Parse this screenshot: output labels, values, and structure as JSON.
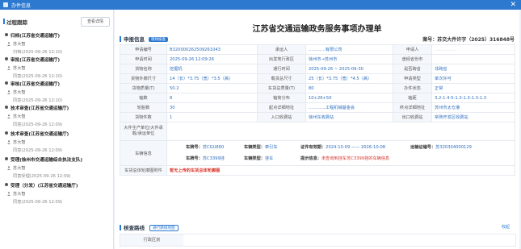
{
  "window": {
    "title": "办件信息",
    "close_glyph": "✕"
  },
  "sidebar": {
    "title": "过程跟踪",
    "view_btn": "查看详情",
    "items": [
      {
        "name": "归档(江苏省交通运输厅)",
        "user": "苏大智",
        "time": "归档(2025-09-26 12:10)"
      },
      {
        "name": "审批(江苏省交通运输厅)",
        "user": "苏大智",
        "time": "同意(2025-09-26 12:10)"
      },
      {
        "name": "审核(江苏省交通运输厅)",
        "user": "苏大智",
        "time": "同意(2025-09-26 12:10)"
      },
      {
        "name": "技术审查(江苏省交通运输厅)",
        "user": "苏大智",
        "time": "同意(2025-09-26 12:09)"
      },
      {
        "name": "技术审查(江苏省交通运输厅)",
        "user": "苏大智",
        "time": "同意(2025-09-26 12:09)"
      },
      {
        "name": "受理(徐州市交通运输综合执法支队)",
        "user": "苏大智",
        "time": "同意受理(2025-09-26 12:09)"
      },
      {
        "name": "受理（分发）(江苏省交通运输厅)",
        "user": "苏大智",
        "time": "同意(2025-09-26 12:09)"
      }
    ]
  },
  "main": {
    "doc_title": "江苏省交通运输政务服务事项办理单",
    "section1": "申报信息",
    "section1_tag": "现场核查",
    "serial": "案号：苏交大件许字（2025）316848号",
    "table": {
      "r1": [
        "申请编号",
        "B320000262509261043",
        "承运人",
        "…………有限公司",
        "申请人",
        "……………"
      ],
      "r2": [
        "申请时间",
        "2025-09-26 12:09:26",
        "出发地行政区",
        "徐州市→苏州市",
        "途经省份市",
        ""
      ],
      "r3": [
        "货物名称",
        "挖掘机",
        "通行时间",
        "2025-09-26 ~ 2025-09-30",
        "是否跨省",
        "非跨省"
      ],
      "r4": [
        "货物外廓尺寸",
        "14（长）*3.75（宽）*3.5（高）",
        "载货总尺寸",
        "25（长）*3.75（宽）*4.5（高）",
        "申请类型",
        "单次许可"
      ],
      "r5": [
        "货物质量(T)",
        "50.2",
        "车货总质量(T)",
        "80",
        "办件状态",
        "正常"
      ],
      "r6": [
        "轴数",
        "8",
        "轴荷分布",
        "10+26+50",
        "轴距",
        "3.2-1.4-5-1.3-1.3-1.3-1.3"
      ],
      "r7": [
        "轮胎数",
        "30",
        "起点详细地址",
        "…………工程机械基金会",
        "终点详细地址",
        "苏州市太仓港"
      ],
      "r8": [
        "货物件数",
        "1",
        "入口收费站",
        "徐州东收费站",
        "出口收费站",
        "常熟开发区收费站"
      ],
      "r9": [
        "大件生产单位/大件承载/承运单位",
        ""
      ],
      "vehicle_label": "车辆信息",
      "v1": [
        "车牌号：",
        "苏CGU860",
        "车辆类型：",
        "牵引车",
        "证件有效期：",
        "2024-10-09 —— 2026-10-08",
        "运输证编号：",
        "苏320304000129"
      ],
      "v2": [
        "车牌号：",
        "苏C3399挂",
        "车辆类型：",
        "挂车",
        "提示信息：",
        "未查询到挂车苏C3399挂的车辆信息"
      ],
      "r10": [
        "车货总体轮廓图附件",
        "暂无上传的车货总体轮廓图"
      ]
    },
    "section2": "核查路线",
    "section2_tag": "通行路线地图",
    "collapse": "收起",
    "area_label": "行政区划"
  }
}
